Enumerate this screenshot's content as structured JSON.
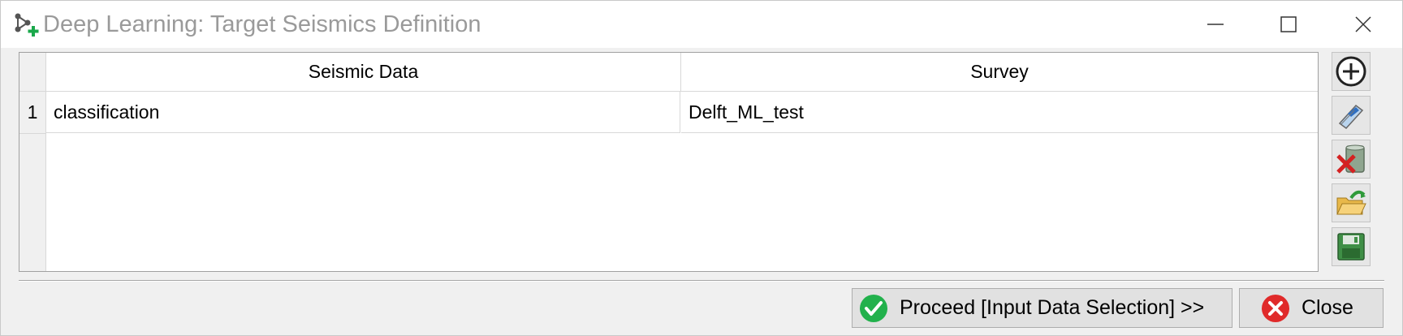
{
  "window": {
    "title": "Deep Learning: Target Seismics Definition",
    "app_icon": "network-add-icon",
    "controls": [
      "minimize-icon",
      "maximize-icon",
      "close-icon"
    ]
  },
  "table": {
    "columns": [
      "Seismic Data",
      "Survey"
    ],
    "rows": [
      {
        "num": "1",
        "seismic_data": "classification",
        "survey": "Delft_ML_test"
      }
    ]
  },
  "side_toolbar": [
    {
      "name": "add-icon"
    },
    {
      "name": "edit-icon"
    },
    {
      "name": "delete-icon"
    },
    {
      "name": "open-folder-icon"
    },
    {
      "name": "save-icon"
    }
  ],
  "buttons": {
    "proceed_label": "Proceed [Input Data Selection] >>",
    "close_label": "Close"
  },
  "colors": {
    "proceed_icon": "#22b14c",
    "close_icon": "#e02a2a",
    "title_text": "#9a9a9a"
  }
}
